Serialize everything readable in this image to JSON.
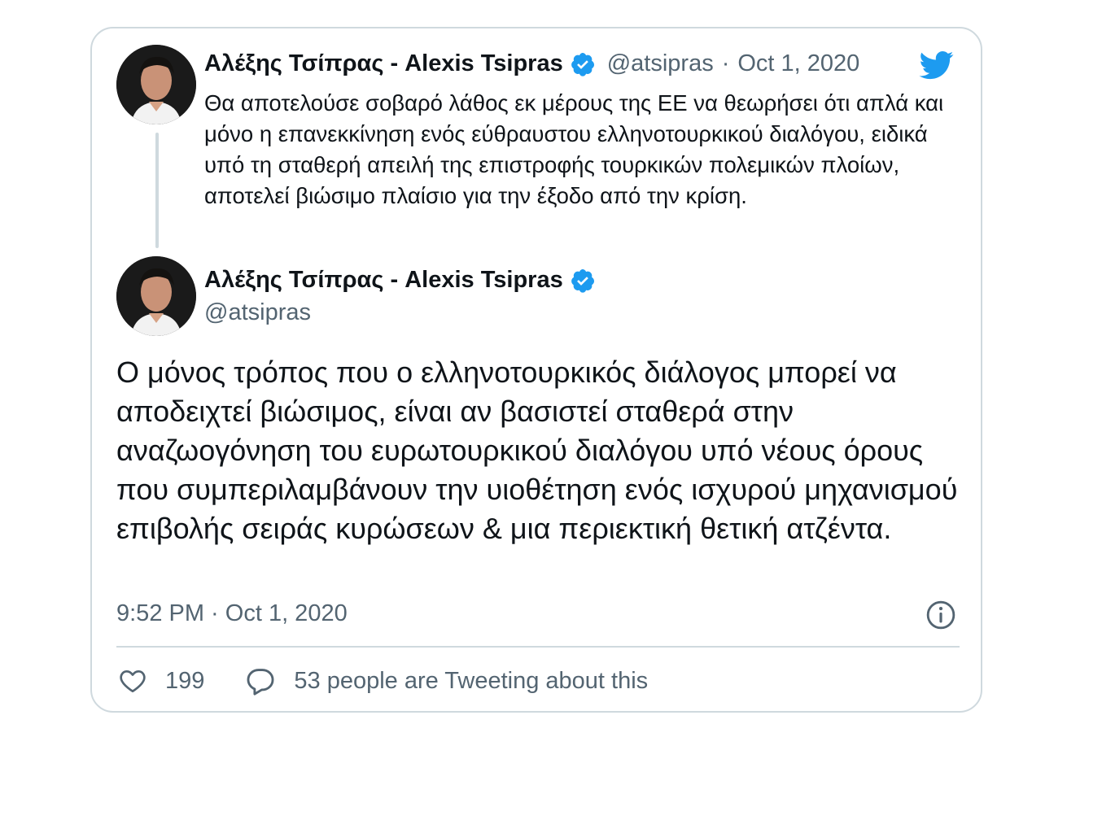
{
  "parent_tweet": {
    "author_name": "Αλέξης Τσίπρας - Alexis Tsipras",
    "handle": "@atsipras",
    "separator": "·",
    "date": "Oct 1, 2020",
    "text": "Θα αποτελούσε σοβαρό λάθος εκ μέρους της ΕΕ να θεωρήσει ότι απλά και μόνο η επανεκκίνηση ενός εύθραυστου ελληνοτουρκικού διαλόγου, ειδικά υπό τη σταθερή απειλή της επιστροφής τουρκικών πολεμικών πλοίων, αποτελεί βιώσιμο πλαίσιο για την έξοδο από την κρίση."
  },
  "main_tweet": {
    "author_name": "Αλέξης Τσίπρας - Alexis Tsipras",
    "handle": "@atsipras",
    "text": "Ο μόνος τρόπος που ο ελληνοτουρκικός διάλογος μπορεί να αποδειχτεί βιώσιμος, είναι αν βασιστεί σταθερά στην αναζωογόνηση του ευρωτουρκικού διαλόγου υπό νέους όρους που συμπεριλαμβάνουν την υιοθέτηση ενός ισχυρού μηχανισμού επιβολής σειράς κυρώσεων & μια περιεκτική θετική ατζέντα.",
    "timestamp": "9:52 PM · Oct 1, 2020"
  },
  "actions": {
    "likes_count": "199",
    "conversation_label": "53 people are Tweeting about this"
  },
  "icons": {
    "brand": "twitter-bird-icon",
    "verified": "verified-badge-icon",
    "info": "info-icon",
    "like": "heart-icon",
    "reply": "speech-bubble-icon"
  },
  "colors": {
    "brand_blue": "#1d9bf0",
    "secondary_text": "#536471",
    "border": "#cfd9de"
  }
}
